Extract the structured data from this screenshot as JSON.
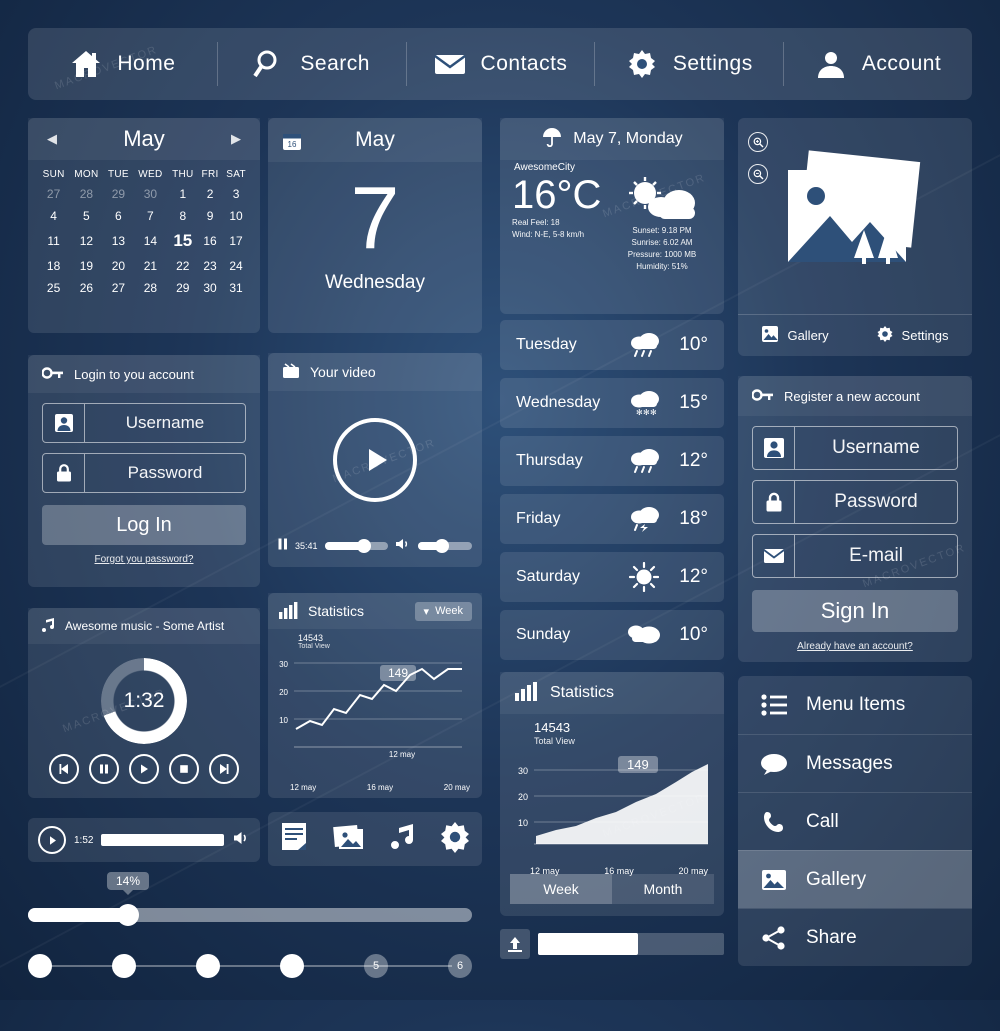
{
  "nav": {
    "items": [
      {
        "label": "Home",
        "icon": "home-icon"
      },
      {
        "label": "Search",
        "icon": "search-icon"
      },
      {
        "label": "Contacts",
        "icon": "envelope-icon"
      },
      {
        "label": "Settings",
        "icon": "gear-icon"
      },
      {
        "label": "Account",
        "icon": "user-icon"
      }
    ]
  },
  "calendar": {
    "title": "May",
    "prev": "◀",
    "next": "▶",
    "weekdays": [
      "SUN",
      "MON",
      "TUE",
      "WED",
      "THU",
      "FRI",
      "SAT"
    ],
    "weeks": [
      [
        {
          "d": "27",
          "dim": true
        },
        {
          "d": "28",
          "dim": true
        },
        {
          "d": "29",
          "dim": true
        },
        {
          "d": "30",
          "dim": true
        },
        {
          "d": "1"
        },
        {
          "d": "2"
        },
        {
          "d": "3"
        }
      ],
      [
        {
          "d": "4"
        },
        {
          "d": "5"
        },
        {
          "d": "6"
        },
        {
          "d": "7"
        },
        {
          "d": "8"
        },
        {
          "d": "9"
        },
        {
          "d": "10"
        }
      ],
      [
        {
          "d": "11"
        },
        {
          "d": "12"
        },
        {
          "d": "13"
        },
        {
          "d": "14"
        },
        {
          "d": "15",
          "today": true
        },
        {
          "d": "16"
        },
        {
          "d": "17"
        }
      ],
      [
        {
          "d": "18"
        },
        {
          "d": "19"
        },
        {
          "d": "20"
        },
        {
          "d": "21"
        },
        {
          "d": "22"
        },
        {
          "d": "23"
        },
        {
          "d": "24"
        }
      ],
      [
        {
          "d": "25"
        },
        {
          "d": "26"
        },
        {
          "d": "27"
        },
        {
          "d": "28"
        },
        {
          "d": "29"
        },
        {
          "d": "30"
        },
        {
          "d": "31"
        }
      ]
    ]
  },
  "login": {
    "title": "Login to you account",
    "username_placeholder": "Username",
    "password_placeholder": "Password",
    "submit_label": "Log In",
    "forgot_label": "Forgot you password?"
  },
  "music": {
    "title": "Awesome music - Some Artist",
    "time": "1:32",
    "controls": [
      "prev",
      "pause",
      "play",
      "stop",
      "next"
    ]
  },
  "miniplayer": {
    "time": "1:52"
  },
  "slider": {
    "value_label": "14%"
  },
  "steps": {
    "labels": [
      "",
      "",
      "",
      "",
      "5",
      "6"
    ]
  },
  "bigdate": {
    "month": "May",
    "day_number": "7",
    "weekday": "Wednesday"
  },
  "video": {
    "title": "Your video",
    "time": "35:41"
  },
  "stats_small": {
    "title": "Statistics",
    "range_label": "Week",
    "total_value": "14543",
    "total_label": "Total View",
    "tooltip": "149"
  },
  "iconrow": {
    "icons": [
      "document-icon",
      "photos-icon",
      "music-note-icon",
      "gear-icon"
    ]
  },
  "weather": {
    "title": "May 7, Monday",
    "city": "AwesomeCity",
    "temp": "16°C",
    "real_feel": "Real Feel: 18",
    "wind": "Wind: N-E, 5-8 km/h",
    "sunset": "Sunset: 9.18 PM",
    "sunrise": "Sunrise: 6.02 AM",
    "pressure": "Pressure: 1000 MB",
    "humidity": "Humidity: 51%"
  },
  "forecast": [
    {
      "day": "Tuesday",
      "temp": "10°",
      "icon": "rain-icon"
    },
    {
      "day": "Wednesday",
      "temp": "15°",
      "icon": "snow-icon"
    },
    {
      "day": "Thursday",
      "temp": "12°",
      "icon": "rain-icon"
    },
    {
      "day": "Friday",
      "temp": "18°",
      "icon": "storm-icon"
    },
    {
      "day": "Saturday",
      "temp": "12°",
      "icon": "sun-icon"
    },
    {
      "day": "Sunday",
      "temp": "10°",
      "icon": "cloud-icon"
    }
  ],
  "stats_big": {
    "title": "Statistics",
    "total_value": "14543",
    "total_label": "Total View",
    "tooltip": "149",
    "tabs": [
      {
        "label": "Week",
        "active": true
      },
      {
        "label": "Month",
        "active": false
      }
    ]
  },
  "gallery": {
    "footer": [
      {
        "label": "Gallery",
        "icon": "gallery-icon"
      },
      {
        "label": "Settings",
        "icon": "gear-icon"
      }
    ]
  },
  "register": {
    "title": "Register a new account",
    "username_placeholder": "Username",
    "password_placeholder": "Password",
    "email_placeholder": "E-mail",
    "submit_label": "Sign In",
    "already_label": "Already have an account?"
  },
  "menu": {
    "items": [
      {
        "label": "Menu Items",
        "icon": "list-icon",
        "selected": false
      },
      {
        "label": "Messages",
        "icon": "speech-bubble-icon",
        "selected": false
      },
      {
        "label": "Call",
        "icon": "phone-icon",
        "selected": false
      },
      {
        "label": "Gallery",
        "icon": "gallery-icon",
        "selected": true
      },
      {
        "label": "Share",
        "icon": "share-icon",
        "selected": false
      }
    ]
  },
  "chart_data": [
    {
      "type": "line",
      "title": "Statistics",
      "x": [
        "12 may",
        "16 may",
        "20 may"
      ],
      "xtick_labels": [
        "12 may",
        "16 may",
        "20 may"
      ],
      "ytick_labels": [
        "10",
        "20",
        "30"
      ],
      "ylim": [
        0,
        35
      ],
      "values": [
        8,
        10,
        9,
        13,
        12,
        16,
        15,
        19,
        18,
        22,
        26,
        24,
        27,
        27
      ],
      "annotation": "149",
      "total_value": "14543",
      "total_label": "Total View",
      "grid": true,
      "legend": "none"
    },
    {
      "type": "area",
      "title": "Statistics",
      "x": [
        "12 may",
        "16 may",
        "20 may"
      ],
      "xtick_labels": [
        "12 may",
        "16 may",
        "20 may"
      ],
      "ytick_labels": [
        "10",
        "20",
        "30"
      ],
      "ylim": [
        0,
        35
      ],
      "values": [
        4,
        6,
        7,
        9,
        10,
        13,
        15,
        18,
        22,
        26,
        30
      ],
      "annotation": "149",
      "total_value": "14543",
      "total_label": "Total View",
      "grid": true,
      "legend": "none"
    }
  ]
}
